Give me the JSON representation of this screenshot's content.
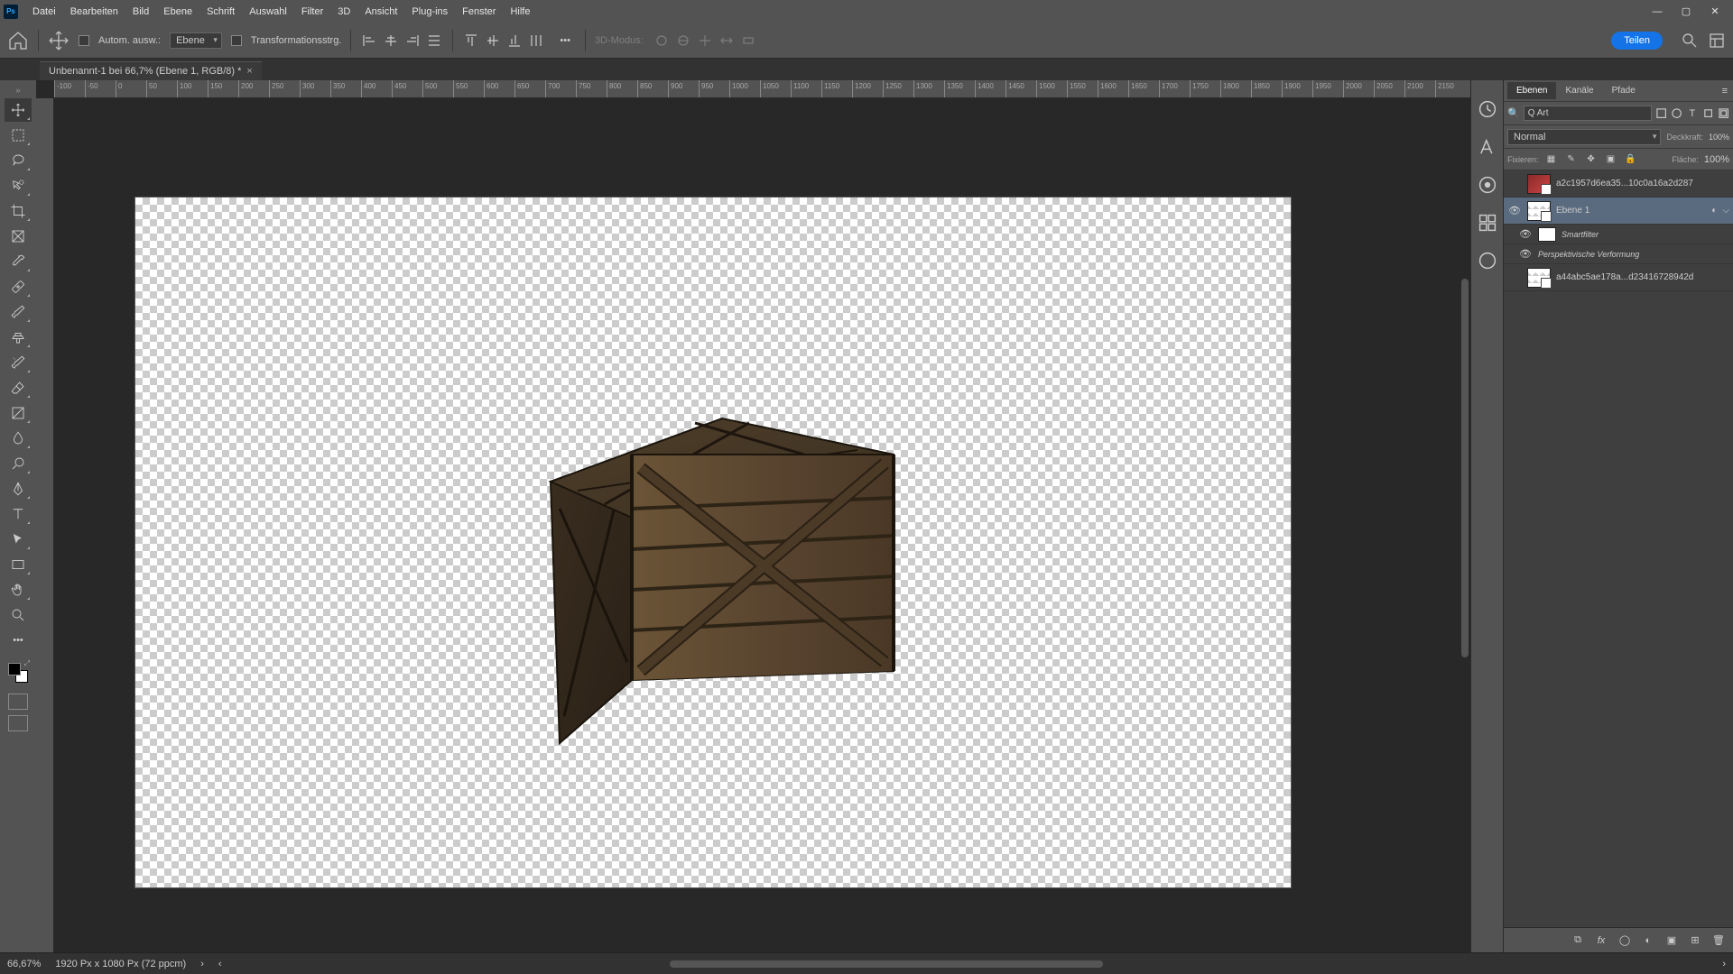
{
  "menubar": [
    "Datei",
    "Bearbeiten",
    "Bild",
    "Ebene",
    "Schrift",
    "Auswahl",
    "Filter",
    "3D",
    "Ansicht",
    "Plug-ins",
    "Fenster",
    "Hilfe"
  ],
  "options": {
    "auto_select_label": "Autom. ausw.:",
    "auto_select_value": "Ebene",
    "transform_label": "Transformationsstrg.",
    "more": "•••",
    "mode_3d_label": "3D-Modus:"
  },
  "share_button": "Teilen",
  "doc_tab": {
    "title": "Unbenannt-1 bei 66,7% (Ebene 1, RGB/8) *"
  },
  "ruler_ticks": [
    "-100",
    "-50",
    "0",
    "50",
    "100",
    "150",
    "200",
    "250",
    "300",
    "350",
    "400",
    "450",
    "500",
    "550",
    "600",
    "650",
    "700",
    "750",
    "800",
    "850",
    "900",
    "950",
    "1000",
    "1050",
    "1100",
    "1150",
    "1200",
    "1250",
    "1300",
    "1350",
    "1400",
    "1450",
    "1500",
    "1550",
    "1600",
    "1650",
    "1700",
    "1750",
    "1800",
    "1850",
    "1900",
    "1950",
    "2000",
    "2050",
    "2100",
    "2150"
  ],
  "panels": {
    "tabs": [
      "Ebenen",
      "Kanäle",
      "Pfade"
    ],
    "filter_label": "Q Art",
    "blend_mode": "Normal",
    "opacity_label": "Deckkraft:",
    "opacity_value": "100%",
    "lock_label": "Fixieren:",
    "fill_label": "Fläche:",
    "fill_value": "100%",
    "layers": [
      {
        "name": "a2c1957d6ea35...10c0a16a2d287",
        "visible": false,
        "selected": false
      },
      {
        "name": "Ebene 1",
        "visible": true,
        "selected": true
      },
      {
        "name": "Smartfilter",
        "sub": true
      },
      {
        "name": "Perspektivische Verformung",
        "sub2": true
      },
      {
        "name": "a44abc5ae178a...d23416728942d",
        "visible": false,
        "selected": false
      }
    ]
  },
  "status": {
    "zoom": "66,67%",
    "dims": "1920 Px x 1080 Px (72 ppcm)"
  }
}
